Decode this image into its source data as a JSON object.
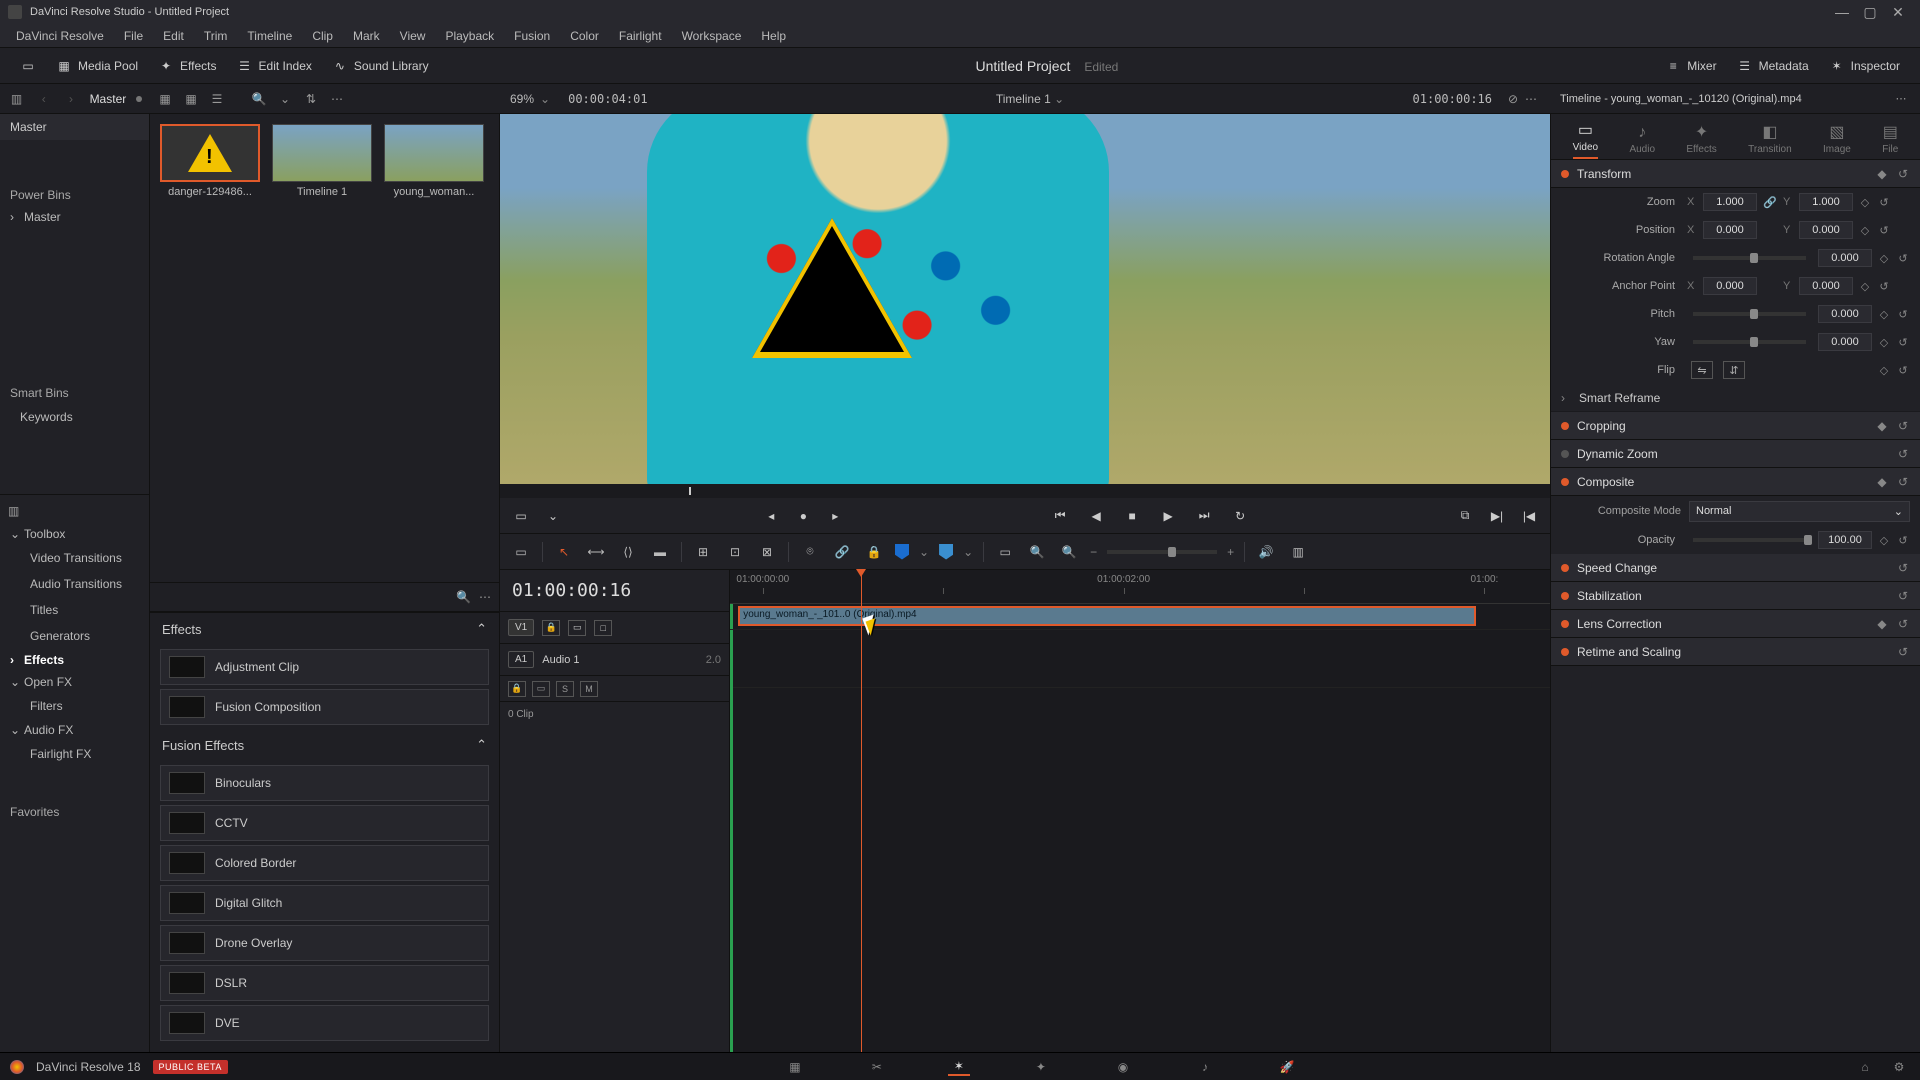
{
  "titlebar": {
    "text": "DaVinci Resolve Studio - Untitled Project"
  },
  "menubar": [
    "DaVinci Resolve",
    "File",
    "Edit",
    "Trim",
    "Timeline",
    "Clip",
    "Mark",
    "View",
    "Playback",
    "Fusion",
    "Color",
    "Fairlight",
    "Workspace",
    "Help"
  ],
  "toptool": {
    "left": [
      {
        "name": "media-pool",
        "label": "Media Pool"
      },
      {
        "name": "effects",
        "label": "Effects"
      },
      {
        "name": "edit-index",
        "label": "Edit Index"
      },
      {
        "name": "sound-library",
        "label": "Sound Library"
      }
    ],
    "title": "Untitled Project",
    "edited": "Edited",
    "right": [
      {
        "name": "mixer",
        "label": "Mixer"
      },
      {
        "name": "metadata",
        "label": "Metadata"
      },
      {
        "name": "inspector",
        "label": "Inspector"
      }
    ]
  },
  "secbar": {
    "master": "Master",
    "zoom_pct": "69%",
    "src_tc": "00:00:04:01",
    "viewer_title": "Timeline 1",
    "viewer_tc": "01:00:00:16",
    "insp_title": "Timeline - young_woman_-_10120 (Original).mp4"
  },
  "left_nav": {
    "master_hdr": "Master",
    "power_bins": "Power Bins",
    "power_items": [
      "Master"
    ],
    "smart_bins": "Smart Bins",
    "smart_items": [
      "Keywords"
    ],
    "toolbox": "Toolbox",
    "toolbox_items": [
      "Video Transitions",
      "Audio Transitions",
      "Titles",
      "Generators"
    ],
    "effects": "Effects",
    "openfx": "Open FX",
    "openfx_items": [
      "Filters"
    ],
    "audiofx": "Audio FX",
    "audiofx_items": [
      "Fairlight FX"
    ],
    "favorites": "Favorites"
  },
  "bins": {
    "thumbs": [
      {
        "name": "danger",
        "label": "danger-129486..."
      },
      {
        "name": "timeline1",
        "label": "Timeline 1"
      },
      {
        "name": "young",
        "label": "young_woman..."
      }
    ]
  },
  "effects_panel": {
    "hdr1": "Effects",
    "group1": [
      "Adjustment Clip",
      "Fusion Composition"
    ],
    "hdr2": "Fusion Effects",
    "group2": [
      "Binoculars",
      "CCTV",
      "Colored Border",
      "Digital Glitch",
      "Drone Overlay",
      "DSLR",
      "DVE"
    ]
  },
  "timeline": {
    "tc": "01:00:00:16",
    "ruler": [
      "01:00:00:00",
      "01:00:02:00",
      "01:00:"
    ],
    "v1": "V1",
    "a1": "A1",
    "a1_label": "Audio 1",
    "a1_ch": "2.0",
    "a1_sub": "0 Clip",
    "sm": "S",
    "mm": "M",
    "clip_name": "young_woman_-_101..0 (Original).mp4"
  },
  "inspector": {
    "tabs": [
      "Video",
      "Audio",
      "Effects",
      "Transition",
      "Image",
      "File"
    ],
    "transform": {
      "title": "Transform",
      "zoom": "Zoom",
      "zoom_x": "1.000",
      "zoom_y": "1.000",
      "position": "Position",
      "pos_x": "0.000",
      "pos_y": "0.000",
      "rotation": "Rotation Angle",
      "rot_v": "0.000",
      "anchor": "Anchor Point",
      "an_x": "0.000",
      "an_y": "0.000",
      "pitch": "Pitch",
      "pitch_v": "0.000",
      "yaw": "Yaw",
      "yaw_v": "0.000",
      "flip": "Flip"
    },
    "sections": {
      "smart_reframe": "Smart Reframe",
      "cropping": "Cropping",
      "dynamic_zoom": "Dynamic Zoom",
      "composite": "Composite",
      "composite_mode_label": "Composite Mode",
      "composite_mode": "Normal",
      "opacity_label": "Opacity",
      "opacity": "100.00",
      "speed": "Speed Change",
      "stab": "Stabilization",
      "lens": "Lens Correction",
      "retime": "Retime and Scaling"
    }
  },
  "bottombar": {
    "app": "DaVinci Resolve 18",
    "badge": "PUBLIC BETA"
  },
  "axis": {
    "x": "X",
    "y": "Y"
  }
}
